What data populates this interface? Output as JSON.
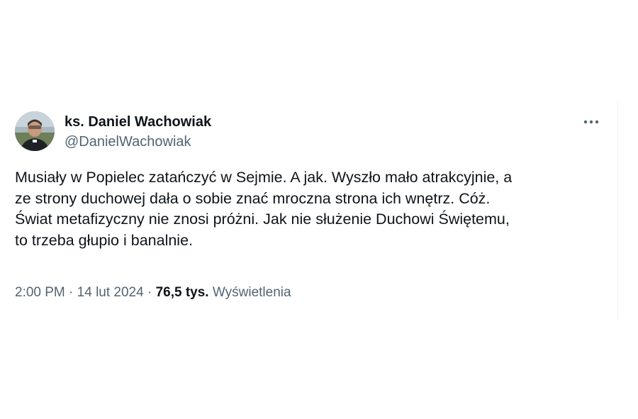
{
  "tweet": {
    "author": {
      "display_name": "ks. Daniel Wachowiak",
      "handle": "@DanielWachowiak"
    },
    "more_icon": "more-horizontal-icon",
    "text": "Musiały w Popielec zatańczyć w Sejmie. A jak. Wyszło mało atrakcyjnie, a\nze strony duchowej dała o sobie znać mroczna strona ich wnętrz. Cóż.\nŚwiat metafizyczny nie znosi próżni. Jak nie służenie Duchowi Świętemu,\nto trzeba głupio i banalnie.",
    "time": "2:00 PM",
    "separator": "·",
    "date": "14 lut 2024",
    "views_count": "76,5 tys.",
    "views_label": "Wyświetlenia"
  },
  "colors": {
    "text_primary": "#0f1419",
    "text_secondary": "#536471"
  }
}
